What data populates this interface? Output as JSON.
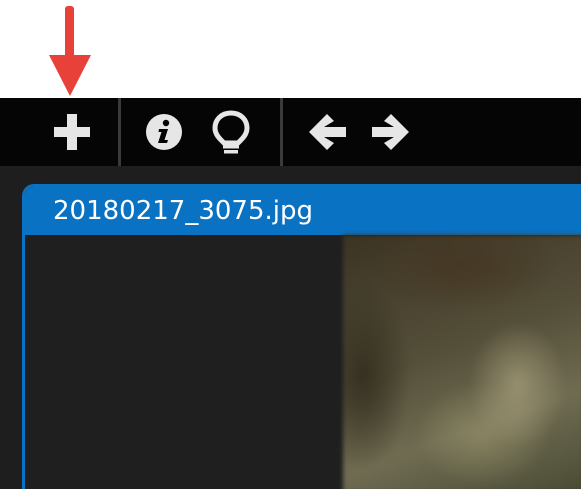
{
  "annotation": {
    "arrow_color": "#e8413a",
    "arrow_icon": "down-arrow-icon"
  },
  "toolbar": {
    "buttons": [
      {
        "icon": "plus-icon"
      },
      {
        "icon": "info-icon"
      },
      {
        "icon": "lightbulb-icon"
      },
      {
        "icon": "arrow-left-icon"
      },
      {
        "icon": "arrow-right-icon"
      }
    ],
    "icon_color": "#e6e6e6",
    "background": "#050505"
  },
  "panel": {
    "title": "20180217_3075.jpg",
    "accent": "#0a72c2"
  }
}
